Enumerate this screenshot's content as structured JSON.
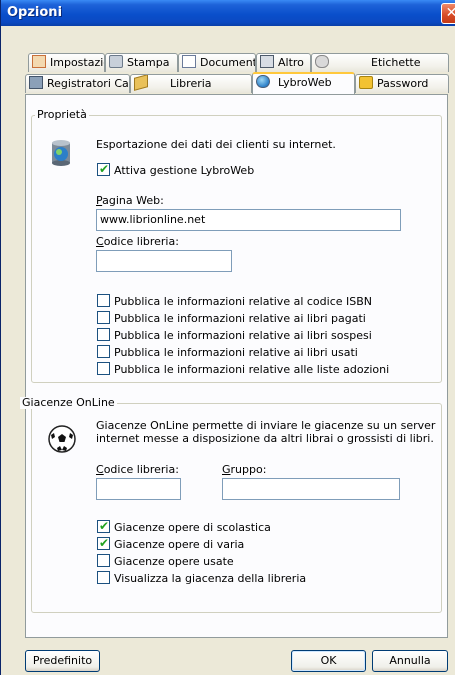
{
  "window": {
    "title": "Opzioni",
    "close_symbol": "✕"
  },
  "tabs": {
    "row1": [
      {
        "label": "Impostazioni",
        "icon": "grid-icon"
      },
      {
        "label": "Stampa",
        "icon": "printer-icon"
      },
      {
        "label": "Documenti",
        "icon": "document-icon"
      },
      {
        "label": "Altro",
        "icon": "keyboard-icon"
      },
      {
        "label": "Etichette",
        "icon": "label-icon"
      }
    ],
    "row2": [
      {
        "label": "Registratori Cassa",
        "icon": "cash-register-icon"
      },
      {
        "label": "Libreria",
        "icon": "books-icon"
      },
      {
        "label": "LybroWeb",
        "icon": "web-icon",
        "active": true
      },
      {
        "label": "Password",
        "icon": "lock-icon"
      }
    ]
  },
  "proprieta": {
    "title": "Proprietà",
    "description": "Esportazione dei dati dei clienti su internet.",
    "enable": {
      "label": "Attiva gestione LybroWeb",
      "checked": true
    },
    "pagina_web": {
      "label_u": "P",
      "label_rest": "agina Web:",
      "value": "www.librionline.net"
    },
    "codice_libreria": {
      "label_u": "C",
      "label_rest": "odice libreria:",
      "value": ""
    },
    "options": [
      {
        "label": "Pubblica le informazioni relative al codice ISBN",
        "checked": false
      },
      {
        "label": "Pubblica le informazioni relative ai libri pagati",
        "checked": false
      },
      {
        "label": "Pubblica le informazioni relative ai libri sospesi",
        "checked": false
      },
      {
        "label": "Pubblica le informazioni relative ai libri usati",
        "checked": false
      },
      {
        "label": "Pubblica le informazioni relative alle liste adozioni",
        "checked": false
      }
    ]
  },
  "giacenze": {
    "title": "Giacenze OnLine",
    "description_line1": "Giacenze OnLine permette di inviare le giacenze su un server",
    "description_line2": "internet messe a disposizione da altri librai o grossisti di libri.",
    "codice_libreria": {
      "label_u": "C",
      "label_rest": "odice libreria:",
      "value": ""
    },
    "gruppo": {
      "label_u": "G",
      "label_rest": "ruppo:",
      "value": ""
    },
    "options": [
      {
        "label": "Giacenze opere di scolastica",
        "checked": true
      },
      {
        "label": "Giacenze opere di varia",
        "checked": true
      },
      {
        "label": "Giacenze opere usate",
        "checked": false
      },
      {
        "label": "Visualizza la giacenza della libreria",
        "checked": false
      }
    ]
  },
  "buttons": {
    "default": "Predefinito",
    "ok": "OK",
    "cancel": "Annulla"
  },
  "checkmark": "✔"
}
